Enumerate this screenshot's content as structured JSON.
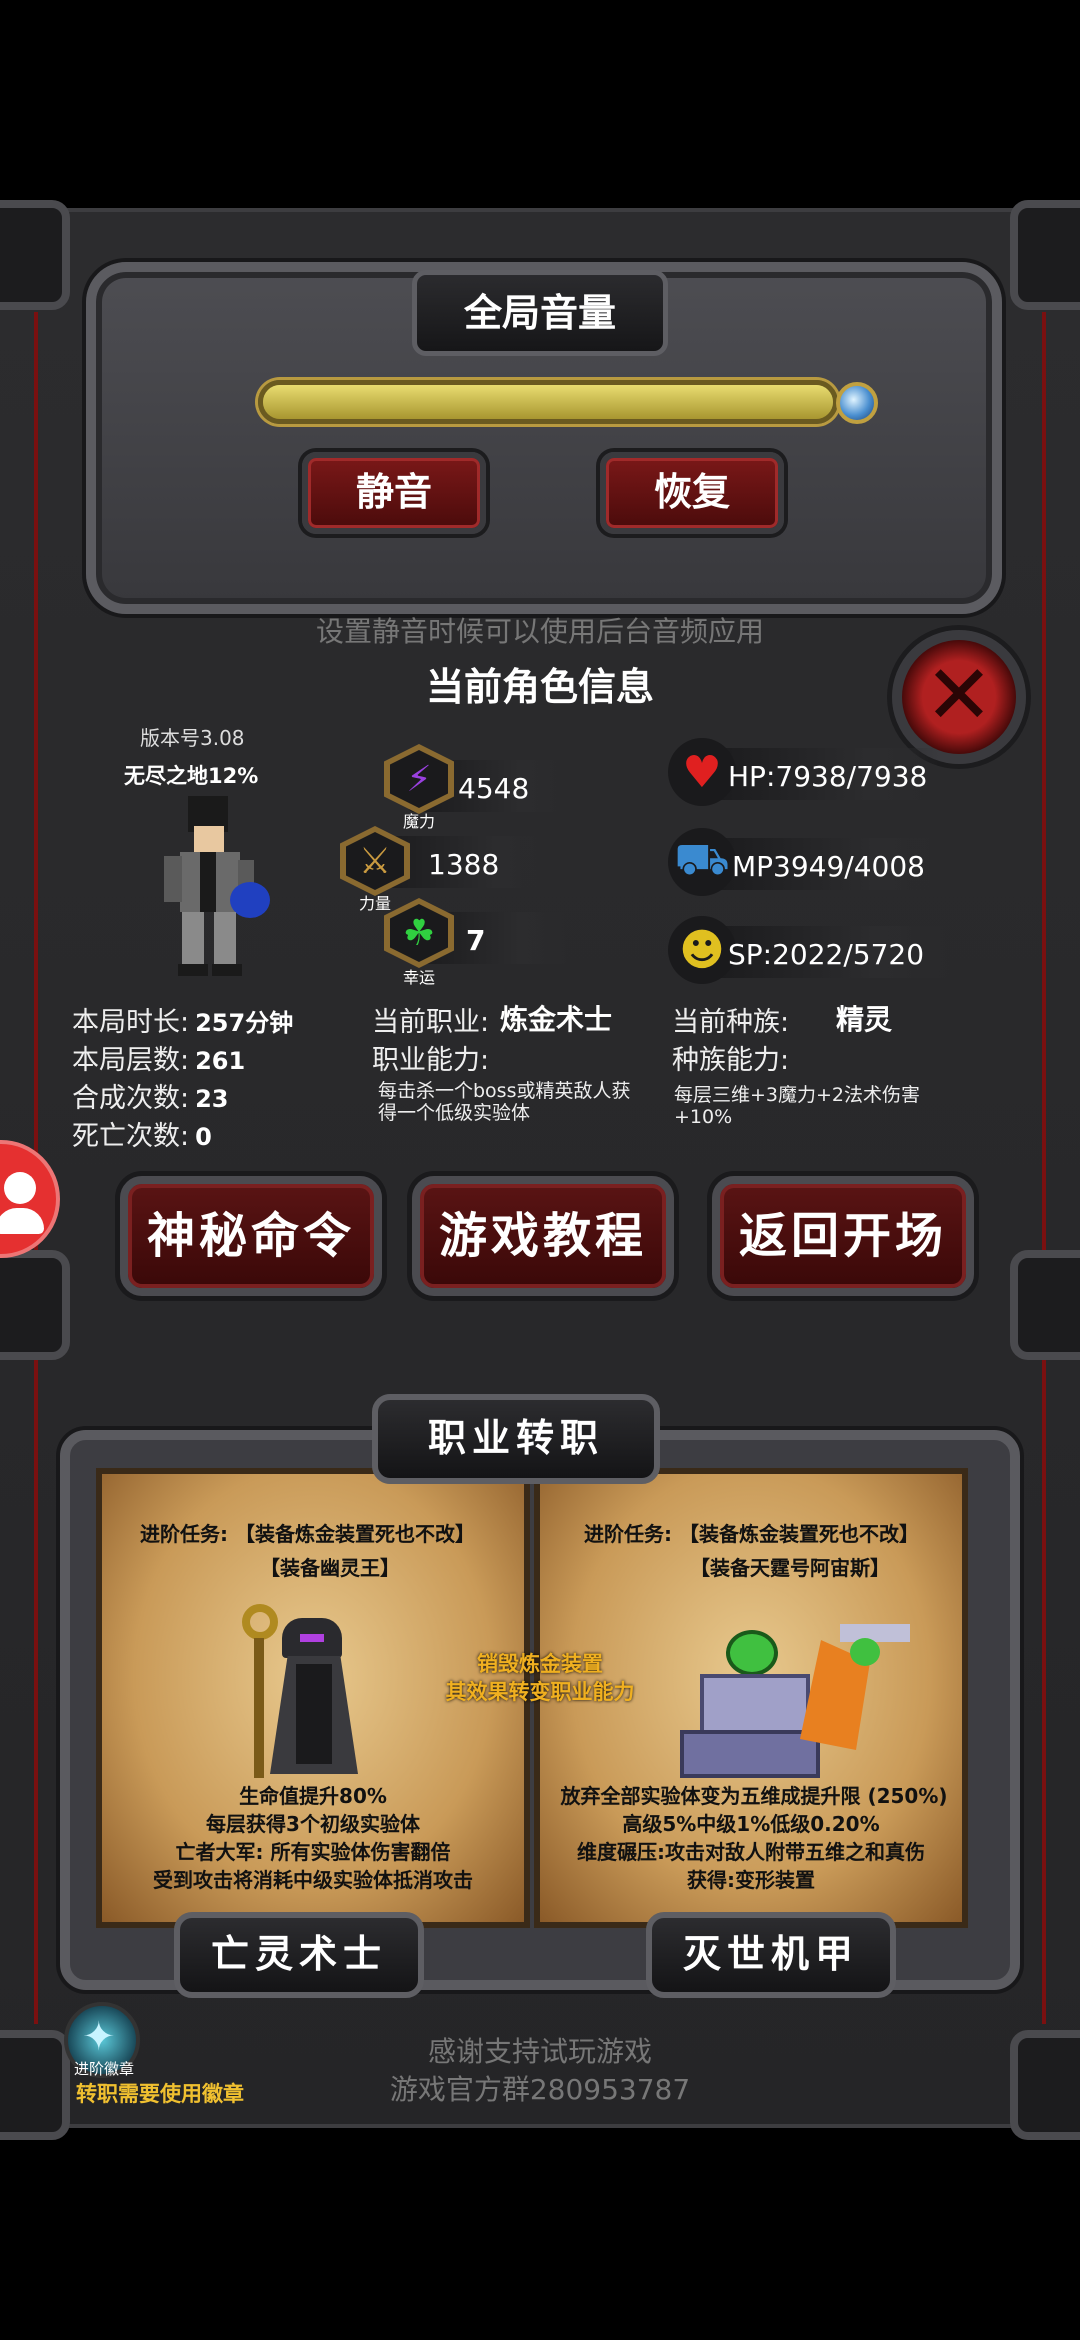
{
  "volume_panel": {
    "title": "全局音量",
    "level": 1.0,
    "mute_label": "静音",
    "restore_label": "恢复",
    "hint": "设置静音时候可以使用后台音频应用"
  },
  "character": {
    "title": "当前角色信息",
    "version": "版本号3.08",
    "location": "无尽之地12%",
    "magic_value": "4548",
    "magic_label": "魔力",
    "strength_value": "1388",
    "strength_label": "力量",
    "luck_value": "7",
    "luck_label": "幸运",
    "hp": "HP:7938/7938",
    "mp": "MP3949/4008",
    "sp": "SP:2022/5720",
    "stats": [
      {
        "label": "本局时长:",
        "value": "257分钟"
      },
      {
        "label": "本局层数:",
        "value": "261"
      },
      {
        "label": "合成次数:",
        "value": "23"
      },
      {
        "label": "死亡次数:",
        "value": "0"
      }
    ],
    "job_label": "当前职业:",
    "job_value": "炼金术士",
    "job_ability_label": "职业能力:",
    "job_ability_text": "每击杀一个boss或精英敌人获得一个低级实验体",
    "race_label": "当前种族:",
    "race_value": "精灵",
    "race_ability_label": "种族能力:",
    "race_ability_text": "每层三维+3魔力+2法术伤害+10%"
  },
  "actions": {
    "secret_command": "神秘命令",
    "tutorial": "游戏教程",
    "back_to_start": "返回开场"
  },
  "job_change": {
    "title": "职业转职",
    "center_note_1": "销毁炼金装置",
    "center_note_2": "其效果转变职业能力",
    "left": {
      "quest_1": "进阶任务: 【装备炼金装置死也不改】",
      "quest_2": "【装备幽灵王】",
      "desc_1": "生命值提升80%",
      "desc_2": "每层获得3个初级实验体",
      "desc_3": "亡者大军: 所有实验体伤害翻倍",
      "desc_4": "受到攻击将消耗中级实验体抵消攻击",
      "name": "亡灵术士"
    },
    "right": {
      "quest_1": "进阶任务: 【装备炼金装置死也不改】",
      "quest_2": "【装备天霆号阿宙斯】",
      "desc_1": "放弃全部实验体变为五维成提升限 (250%)",
      "desc_2": "高级5%中级1%低级0.20%",
      "desc_3": "维度碾压:攻击对敌人附带五维之和真伤",
      "desc_4": "获得:变形装置",
      "name": "灭世机甲"
    }
  },
  "badge": {
    "label": "进阶徽章",
    "note": "转职需要使用徽章"
  },
  "footer": {
    "line1": "感谢支持试玩游戏",
    "line2": "游戏官方群280953787"
  },
  "colors": {
    "accent_red": "#7a1818",
    "gold": "#c9a24a",
    "badge_note": "#f0c030"
  }
}
